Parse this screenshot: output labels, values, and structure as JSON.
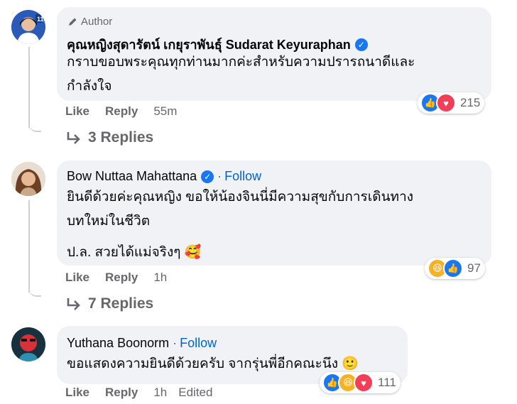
{
  "comments": [
    {
      "badge": "Author",
      "name": "คุณหญิงสุดารัตน์ เกยุราพันธุ์ Sudarat Keyuraphan",
      "verified": true,
      "lines": [
        "กราบขอบพระคุณทุกท่านมากค่ะสำหรับความปรารถนาดีและ",
        "กำลังใจ"
      ],
      "like": "Like",
      "reply": "Reply",
      "time": "55m",
      "reaction_count": "215",
      "reactions": [
        "like-icon",
        "love-icon"
      ],
      "replies": "3 Replies"
    },
    {
      "name": "Bow Nuttaa Mahattana",
      "verified": true,
      "follow_sep": "·",
      "follow": "Follow",
      "lines": [
        "ยินดีด้วยค่ะคุณหญิง ขอให้น้องจินนี่มีความสุขกับการเดินทาง",
        "บทใหม่ในชีวิต",
        "ป.ล. สวยได้แม่จริงๆ 🥰"
      ],
      "like": "Like",
      "reply": "Reply",
      "time": "1h",
      "reaction_count": "97",
      "reactions": [
        "haha-icon",
        "like-icon"
      ],
      "replies": "7 Replies"
    },
    {
      "name": "Yuthana Boonorm",
      "follow_sep": "·",
      "follow": "Follow",
      "lines": [
        "ขอแสดงความยินดีด้วยครับ จากรุ่นพี่อีกคณะนึง 🙂"
      ],
      "like": "Like",
      "reply": "Reply",
      "time": "1h",
      "edited": "Edited",
      "reaction_count": "111",
      "reactions": [
        "like-icon",
        "haha-icon",
        "love-icon"
      ]
    }
  ],
  "colors": {
    "bubble": "#f0f2f5",
    "link": "#0064d1",
    "muted": "#65676b",
    "like": "#1877f2",
    "love": "#f33e58",
    "haha": "#f7b125"
  }
}
